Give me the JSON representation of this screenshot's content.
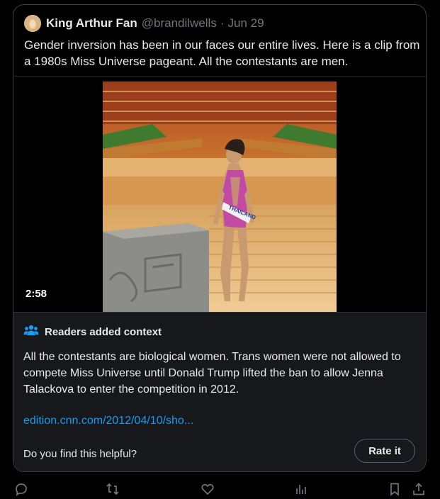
{
  "tweet": {
    "author_name": "King Arthur Fan",
    "handle": "@brandilwells",
    "separator": "·",
    "date": "Jun 29",
    "text": "Gender inversion has been in our faces our entire lives. Here is a clip from a 1980s Miss Universe pageant. All the contestants are men."
  },
  "media": {
    "duration": "2:58",
    "sash_text": "THAILAND"
  },
  "community_note": {
    "title": "Readers added context",
    "body": "All the contestants are biological women. Trans women were not allowed to compete Miss Universe until Donald Trump lifted the ban to allow Jenna Talackova to enter the competition in 2012.",
    "link": "edition.cnn.com/2012/04/10/sho...",
    "helpful_prompt": "Do you find this helpful?",
    "rate_button": "Rate it"
  },
  "actions": [
    "reply-icon",
    "retweet-icon",
    "like-icon",
    "views-icon",
    "bookmark-icon",
    "share-icon"
  ],
  "colors": {
    "background": "#000000",
    "note_background": "#16181c",
    "link": "#1d9bf0",
    "muted": "#71767b",
    "text": "#e7e9ea"
  }
}
